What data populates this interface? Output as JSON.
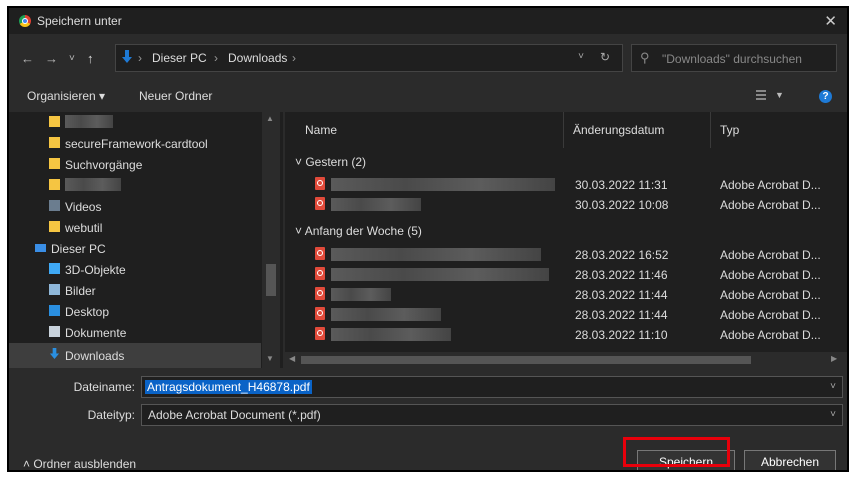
{
  "window": {
    "title": "Speichern unter",
    "close_glyph": "✕"
  },
  "nav": {
    "back": "←",
    "forward": "→",
    "recent": "˅",
    "up": "↑"
  },
  "path": {
    "segments": [
      "Dieser PC",
      "Downloads"
    ],
    "separator": "›"
  },
  "search": {
    "placeholder": "\"Downloads\" durchsuchen"
  },
  "toolbar": {
    "organize": "Organisieren ▾",
    "new_folder": "Neuer Ordner",
    "help": "?"
  },
  "sidebar": {
    "items": [
      {
        "label": "",
        "blurred": true
      },
      {
        "label": "secureFramework-cardtool"
      },
      {
        "label": "Suchvorgänge"
      },
      {
        "label": "",
        "blurred": true
      },
      {
        "label": "Videos"
      },
      {
        "label": "webutil"
      },
      {
        "label": "Dieser PC"
      },
      {
        "label": "3D-Objekte"
      },
      {
        "label": "Bilder"
      },
      {
        "label": "Desktop"
      },
      {
        "label": "Dokumente"
      },
      {
        "label": "Downloads",
        "selected": true
      }
    ]
  },
  "columns": {
    "name": "Name",
    "date": "Änderungsdatum",
    "type": "Typ"
  },
  "groups": [
    {
      "label": "Gestern (2)",
      "files": [
        {
          "date": "30.03.2022 11:31",
          "type": "Adobe Acrobat D..."
        },
        {
          "date": "30.03.2022 10:08",
          "type": "Adobe Acrobat D..."
        }
      ]
    },
    {
      "label": "Anfang der Woche (5)",
      "files": [
        {
          "date": "28.03.2022 16:52",
          "type": "Adobe Acrobat D..."
        },
        {
          "date": "28.03.2022 11:46",
          "type": "Adobe Acrobat D..."
        },
        {
          "date": "28.03.2022 11:44",
          "type": "Adobe Acrobat D..."
        },
        {
          "date": "28.03.2022 11:44",
          "type": "Adobe Acrobat D..."
        },
        {
          "date": "28.03.2022 11:10",
          "type": "Adobe Acrobat D..."
        }
      ]
    }
  ],
  "form": {
    "filename_label": "Dateiname:",
    "filename_value": "Antragsdokument_H46878.pdf",
    "filetype_label": "Dateityp:",
    "filetype_value": "Adobe Acrobat Document (*.pdf)"
  },
  "footer": {
    "hide_folders": "Ordner ausblenden",
    "save": "Speichern",
    "cancel": "Abbrechen"
  },
  "colors": {
    "highlight": "#e8000b",
    "accent": "#0a63c7"
  }
}
